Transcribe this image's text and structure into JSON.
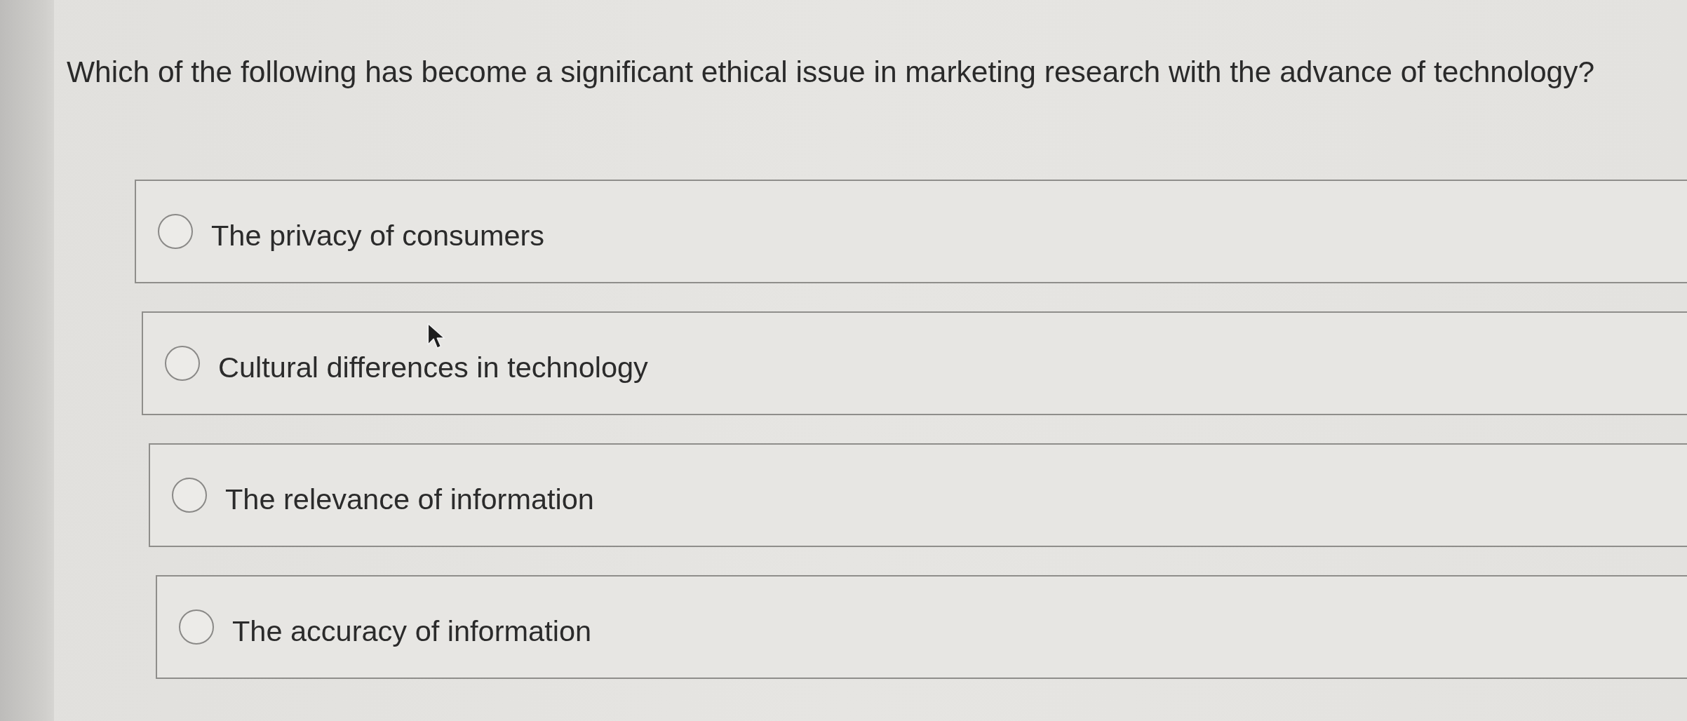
{
  "question": {
    "text": "Which of the following has become a significant ethical issue in marketing research with the advance of technology?"
  },
  "options": [
    {
      "label": "The privacy of consumers",
      "selected": false
    },
    {
      "label": "Cultural differences in technology",
      "selected": false
    },
    {
      "label": "The relevance of information",
      "selected": false
    },
    {
      "label": "The accuracy of information",
      "selected": false
    }
  ]
}
